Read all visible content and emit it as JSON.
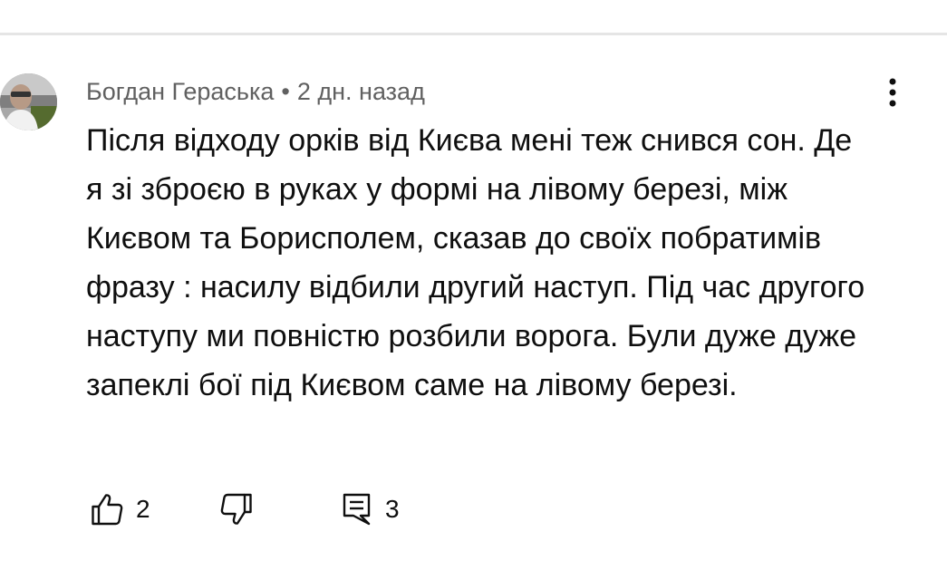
{
  "comment": {
    "author": "Богдан Гераська",
    "separator": "•",
    "time_ago": "2 дн. назад",
    "text": "Після відходу орків від Києва мені теж снився сон. Де я зі зброєю в руках у формі на лівому березі, між Києвом та Борисполем, сказав до своїх побратимів фразу : насилу відбили другий наступ. Під час другого наступу ми повністю розбили ворога. Були дуже дуже запеклі бої під Києвом саме на лівому березі.",
    "likes": "2",
    "replies": "3"
  },
  "icons": {
    "more": "more-vertical-icon",
    "like": "thumbs-up-icon",
    "dislike": "thumbs-down-icon",
    "reply": "comment-icon"
  },
  "colors": {
    "meta_text": "#606060",
    "body_text": "#0f0f0f",
    "divider": "#e5e5e5"
  }
}
